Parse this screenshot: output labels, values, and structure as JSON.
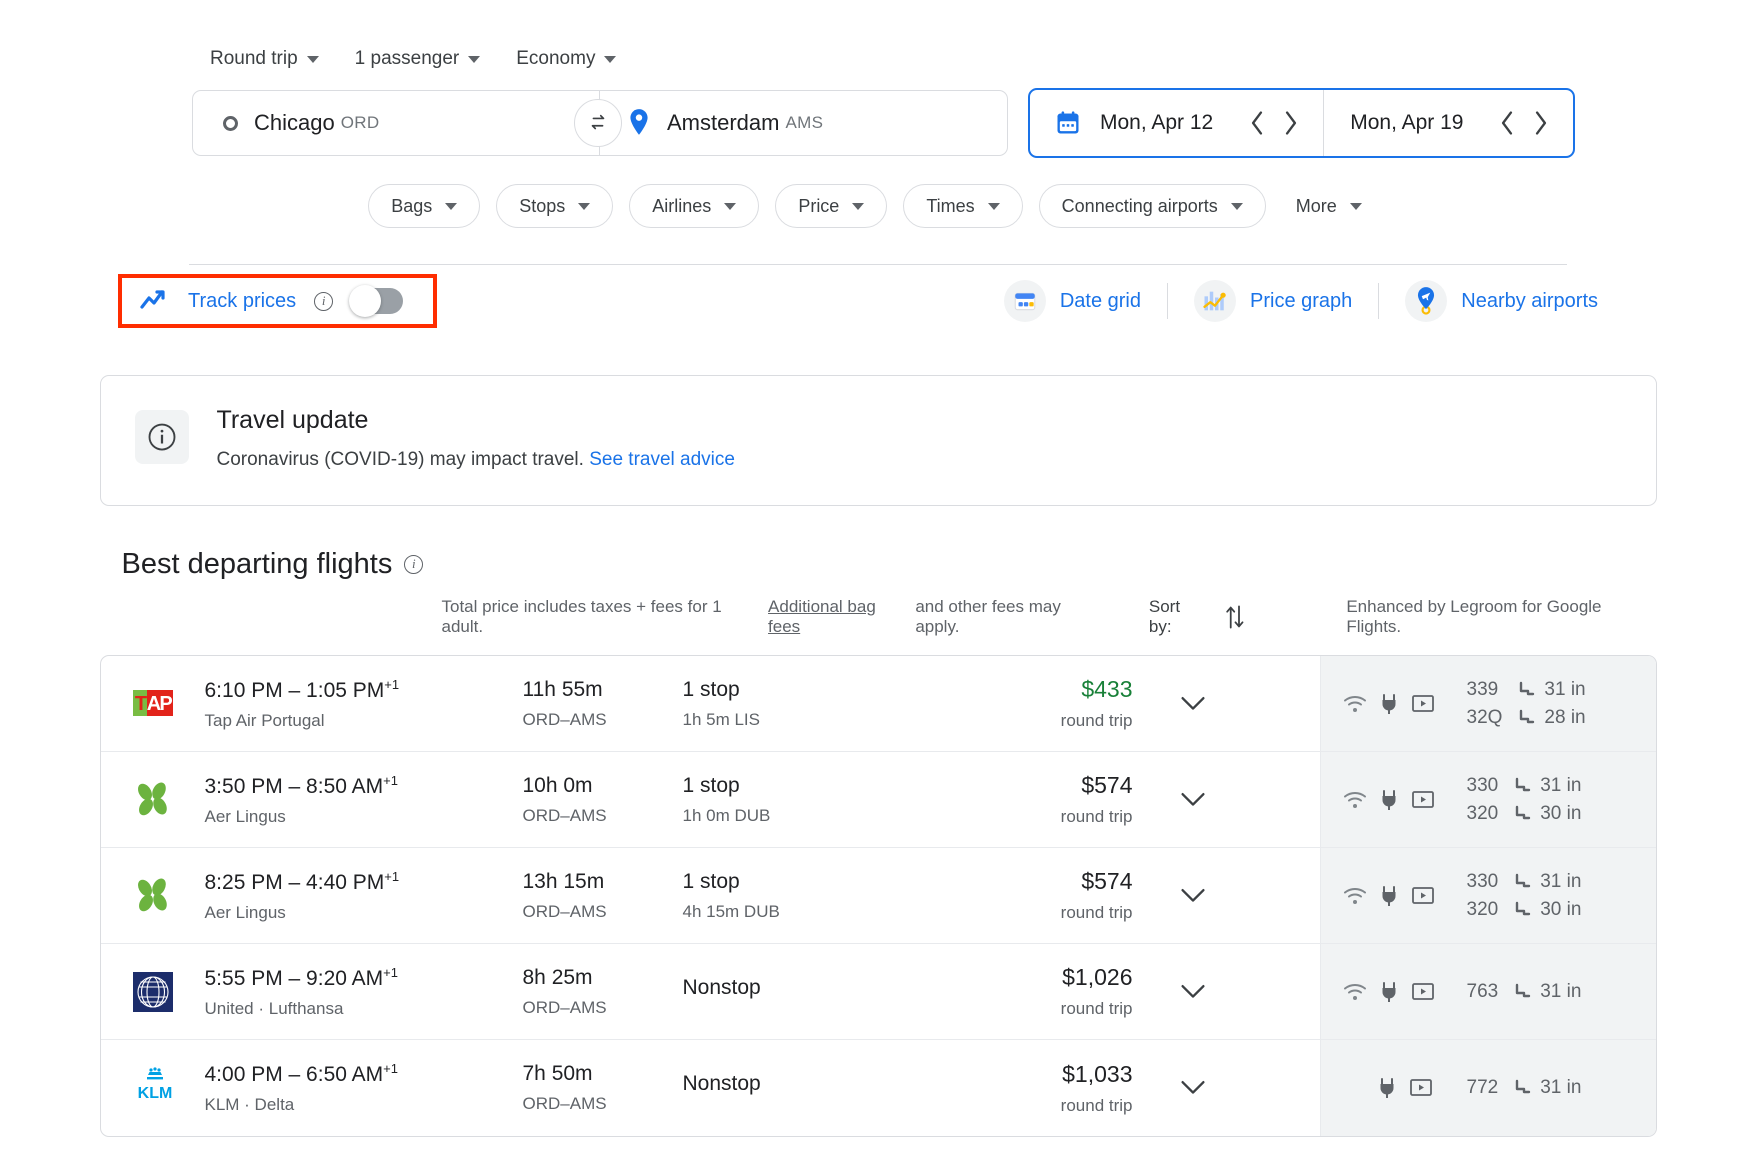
{
  "search": {
    "trip_type": "Round trip",
    "passengers": "1 passenger",
    "cabin": "Economy",
    "origin_city": "Chicago",
    "origin_code": "ORD",
    "destination_city": "Amsterdam",
    "destination_code": "AMS",
    "depart_date": "Mon, Apr 12",
    "return_date": "Mon, Apr 19"
  },
  "filters": [
    {
      "label": "Bags"
    },
    {
      "label": "Stops"
    },
    {
      "label": "Airlines"
    },
    {
      "label": "Price"
    },
    {
      "label": "Times"
    },
    {
      "label": "Connecting airports"
    },
    {
      "label": "More"
    }
  ],
  "tools": {
    "track_prices_label": "Track prices",
    "track_prices_enabled": false,
    "date_grid": "Date grid",
    "price_graph": "Price graph",
    "nearby_airports": "Nearby airports"
  },
  "travel_update": {
    "title": "Travel update",
    "body": "Coronavirus (COVID-19) may impact travel.",
    "link": "See travel advice"
  },
  "results": {
    "heading": "Best departing flights",
    "disclaimer_1": "Total price includes taxes + fees for 1 adult.",
    "disclaimer_link": "Additional bag fees",
    "disclaimer_2": "and other fees may apply.",
    "sort_by": "Sort by:",
    "enhanced": "Enhanced by Legroom for Google Flights."
  },
  "flights": [
    {
      "logo": "tap-air-portugal-logo",
      "times": "6:10 PM – 1:05 PM",
      "next_day": "+1",
      "airline": "Tap Air Portugal",
      "duration": "11h 55m",
      "route": "ORD–AMS",
      "stops": "1 stop",
      "stop_detail": "1h 5m LIS",
      "price": "$433",
      "price_note": "round trip",
      "price_color": "#188038",
      "amenities": [
        "wifi-icon",
        "power-icon",
        "video-icon"
      ],
      "aircraft": [
        {
          "code": "339",
          "legroom": "31 in"
        },
        {
          "code": "32Q",
          "legroom": "28 in"
        }
      ]
    },
    {
      "logo": "aer-lingus-logo",
      "times": "3:50 PM – 8:50 AM",
      "next_day": "+1",
      "airline": "Aer Lingus",
      "duration": "10h 0m",
      "route": "ORD–AMS",
      "stops": "1 stop",
      "stop_detail": "1h 0m DUB",
      "price": "$574",
      "price_note": "round trip",
      "price_color": "#202124",
      "amenities": [
        "wifi-icon",
        "power-icon",
        "video-icon"
      ],
      "aircraft": [
        {
          "code": "330",
          "legroom": "31 in"
        },
        {
          "code": "320",
          "legroom": "30 in"
        }
      ]
    },
    {
      "logo": "aer-lingus-logo",
      "times": "8:25 PM – 4:40 PM",
      "next_day": "+1",
      "airline": "Aer Lingus",
      "duration": "13h 15m",
      "route": "ORD–AMS",
      "stops": "1 stop",
      "stop_detail": "4h 15m DUB",
      "price": "$574",
      "price_note": "round trip",
      "price_color": "#202124",
      "amenities": [
        "wifi-icon",
        "power-icon",
        "video-icon"
      ],
      "aircraft": [
        {
          "code": "330",
          "legroom": "31 in"
        },
        {
          "code": "320",
          "legroom": "30 in"
        }
      ]
    },
    {
      "logo": "united-logo",
      "times": "5:55 PM – 9:20 AM",
      "next_day": "+1",
      "airline": "United · Lufthansa",
      "duration": "8h 25m",
      "route": "ORD–AMS",
      "stops": "Nonstop",
      "stop_detail": "",
      "price": "$1,026",
      "price_note": "round trip",
      "price_color": "#202124",
      "amenities": [
        "wifi-icon",
        "power-icon",
        "video-icon"
      ],
      "aircraft": [
        {
          "code": "763",
          "legroom": "31 in"
        }
      ]
    },
    {
      "logo": "klm-logo",
      "times": "4:00 PM – 6:50 AM",
      "next_day": "+1",
      "airline": "KLM · Delta",
      "duration": "7h 50m",
      "route": "ORD–AMS",
      "stops": "Nonstop",
      "stop_detail": "",
      "price": "$1,033",
      "price_note": "round trip",
      "price_color": "#202124",
      "amenities": [
        "power-icon",
        "video-icon"
      ],
      "aircraft": [
        {
          "code": "772",
          "legroom": "31 in"
        }
      ]
    }
  ],
  "colors": {
    "accent": "#1a73e8",
    "price_green": "#188038",
    "highlight_box": "#ff2d00"
  }
}
